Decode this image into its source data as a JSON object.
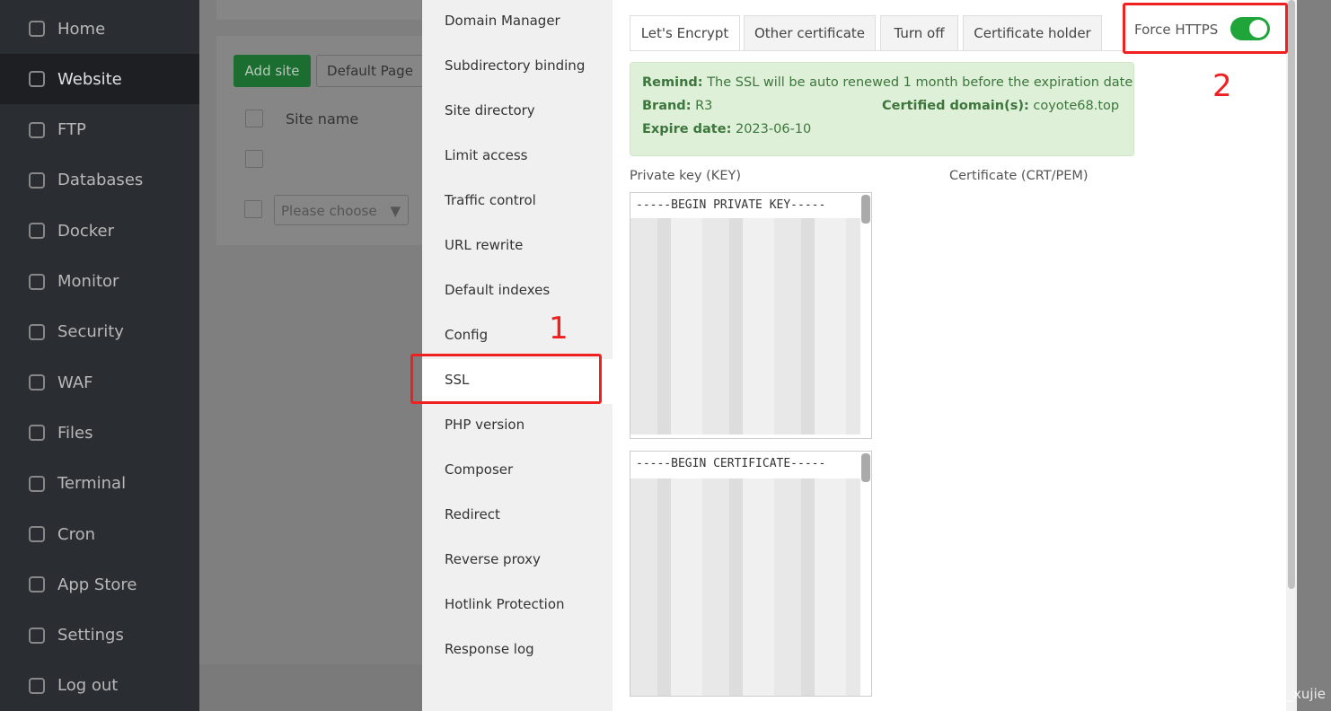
{
  "sidebar": {
    "items": [
      {
        "label": "Home",
        "icon": "home-icon"
      },
      {
        "label": "Website",
        "icon": "globe-icon",
        "active": true
      },
      {
        "label": "FTP",
        "icon": "ftp-icon"
      },
      {
        "label": "Databases",
        "icon": "database-icon"
      },
      {
        "label": "Docker",
        "icon": "docker-icon"
      },
      {
        "label": "Monitor",
        "icon": "monitor-icon"
      },
      {
        "label": "Security",
        "icon": "shield-icon"
      },
      {
        "label": "WAF",
        "icon": "waf-shield-icon"
      },
      {
        "label": "Files",
        "icon": "folder-icon"
      },
      {
        "label": "Terminal",
        "icon": "terminal-icon"
      },
      {
        "label": "Cron",
        "icon": "calendar-icon"
      },
      {
        "label": "App Store",
        "icon": "grid-icon"
      },
      {
        "label": "Settings",
        "icon": "gear-icon"
      },
      {
        "label": "Log out",
        "icon": "logout-icon"
      }
    ]
  },
  "background": {
    "add_site": "Add site",
    "default_page": "Default Page",
    "col_site_name": "Site name",
    "please_choose": "Please choose"
  },
  "modal": {
    "nav": [
      "Domain Manager",
      "Subdirectory binding",
      "Site directory",
      "Limit access",
      "Traffic control",
      "URL rewrite",
      "Default indexes",
      "Config",
      "SSL",
      "PHP version",
      "Composer",
      "Redirect",
      "Reverse proxy",
      "Hotlink Protection",
      "Response log"
    ],
    "active_nav": "SSL",
    "tabs": [
      "Let's Encrypt",
      "Other certificate",
      "Turn off",
      "Certificate holder"
    ],
    "active_tab": "Let's Encrypt",
    "force_https": {
      "label": "Force HTTPS",
      "on": true,
      "color": "#20a53a"
    },
    "remind": {
      "remind_label": "Remind:",
      "remind_text": "The SSL will be auto renewed 1 month before the expiration date",
      "brand_label": "Brand:",
      "brand": "R3",
      "domain_label": "Certified domain(s):",
      "domain": "coyote68.top",
      "expire_label": "Expire date:",
      "expire": "2023-06-10"
    },
    "key_label": "Private key (KEY)",
    "cert_label": "Certificate (CRT/PEM)",
    "key_first": "-----BEGIN PRIVATE KEY-----",
    "cert_first": "-----BEGIN CERTIFICATE-----"
  },
  "annotations": {
    "one": "1",
    "two": "2"
  },
  "watermark": "CSDN @coyote_xujie"
}
